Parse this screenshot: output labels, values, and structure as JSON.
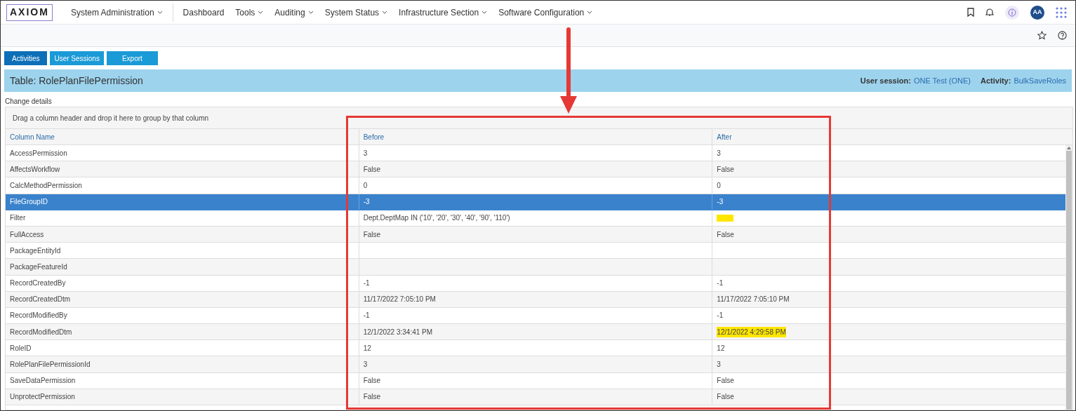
{
  "nav": {
    "logo": "AXIOM",
    "items": [
      {
        "label": "System Administration",
        "dropdown": true
      },
      {
        "label": "Dashboard",
        "dropdown": false
      },
      {
        "label": "Tools",
        "dropdown": true
      },
      {
        "label": "Auditing",
        "dropdown": true
      },
      {
        "label": "System Status",
        "dropdown": true
      },
      {
        "label": "Infrastructure Section",
        "dropdown": true
      },
      {
        "label": "Software Configuration",
        "dropdown": true
      }
    ],
    "avatar": "AA"
  },
  "buttons": [
    {
      "label": "Activities",
      "selected": true
    },
    {
      "label": "User Sessions",
      "selected": false
    },
    {
      "label": "Export",
      "selected": false
    }
  ],
  "header": {
    "title": "Table: RolePlanFilePermission",
    "session_label": "User session:",
    "session_value": "ONE Test (ONE)",
    "activity_label": "Activity:",
    "activity_value": "BulkSaveRoles"
  },
  "section_label": "Change details",
  "group_hint": "Drag a column header and drop it here to group by that column",
  "table": {
    "columns": [
      "Column Name",
      "Before",
      "After"
    ],
    "rows": [
      {
        "name": "AccessPermission",
        "before": "3",
        "after": "3",
        "selected": false,
        "after_highlighted": false
      },
      {
        "name": "AffectsWorkflow",
        "before": "False",
        "after": "False",
        "selected": false,
        "after_highlighted": false
      },
      {
        "name": "CalcMethodPermission",
        "before": "0",
        "after": "0",
        "selected": false,
        "after_highlighted": false
      },
      {
        "name": "FileGroupID",
        "before": "-3",
        "after": "-3",
        "selected": true,
        "after_highlighted": false
      },
      {
        "name": "Filter",
        "before": "Dept.DeptMap IN ('10', '20', '30', '40', '90', '110')",
        "selected": false,
        "after_highlighted": true
      },
      {
        "name": "FullAccess",
        "before": "False",
        "after": "False",
        "selected": false,
        "after_highlighted": false
      },
      {
        "name": "PackageEntityId",
        "selected": false,
        "after_highlighted": false
      },
      {
        "name": "PackageFeatureId",
        "selected": false,
        "after_highlighted": false
      },
      {
        "name": "RecordCreatedBy",
        "before": "-1",
        "after": "-1",
        "selected": false,
        "after_highlighted": false
      },
      {
        "name": "RecordCreatedDtm",
        "before": "11/17/2022 7:05:10 PM",
        "after": "11/17/2022 7:05:10 PM",
        "selected": false,
        "after_highlighted": false
      },
      {
        "name": "RecordModifiedBy",
        "before": "-1",
        "after": "-1",
        "selected": false,
        "after_highlighted": false
      },
      {
        "name": "RecordModifiedDtm",
        "before": "12/1/2022 3:34:41 PM",
        "after": "12/1/2022 4:29:58 PM",
        "selected": false,
        "after_highlighted": true
      },
      {
        "name": "RoleID",
        "before": "12",
        "after": "12",
        "selected": false,
        "after_highlighted": false
      },
      {
        "name": "RolePlanFilePermissionId",
        "before": "3",
        "after": "3",
        "selected": false,
        "after_highlighted": false
      },
      {
        "name": "SaveDataPermission",
        "before": "False",
        "after": "False",
        "selected": false,
        "after_highlighted": false
      },
      {
        "name": "UnprotectPermission",
        "before": "False",
        "after": "False",
        "selected": false,
        "after_highlighted": false
      }
    ]
  }
}
